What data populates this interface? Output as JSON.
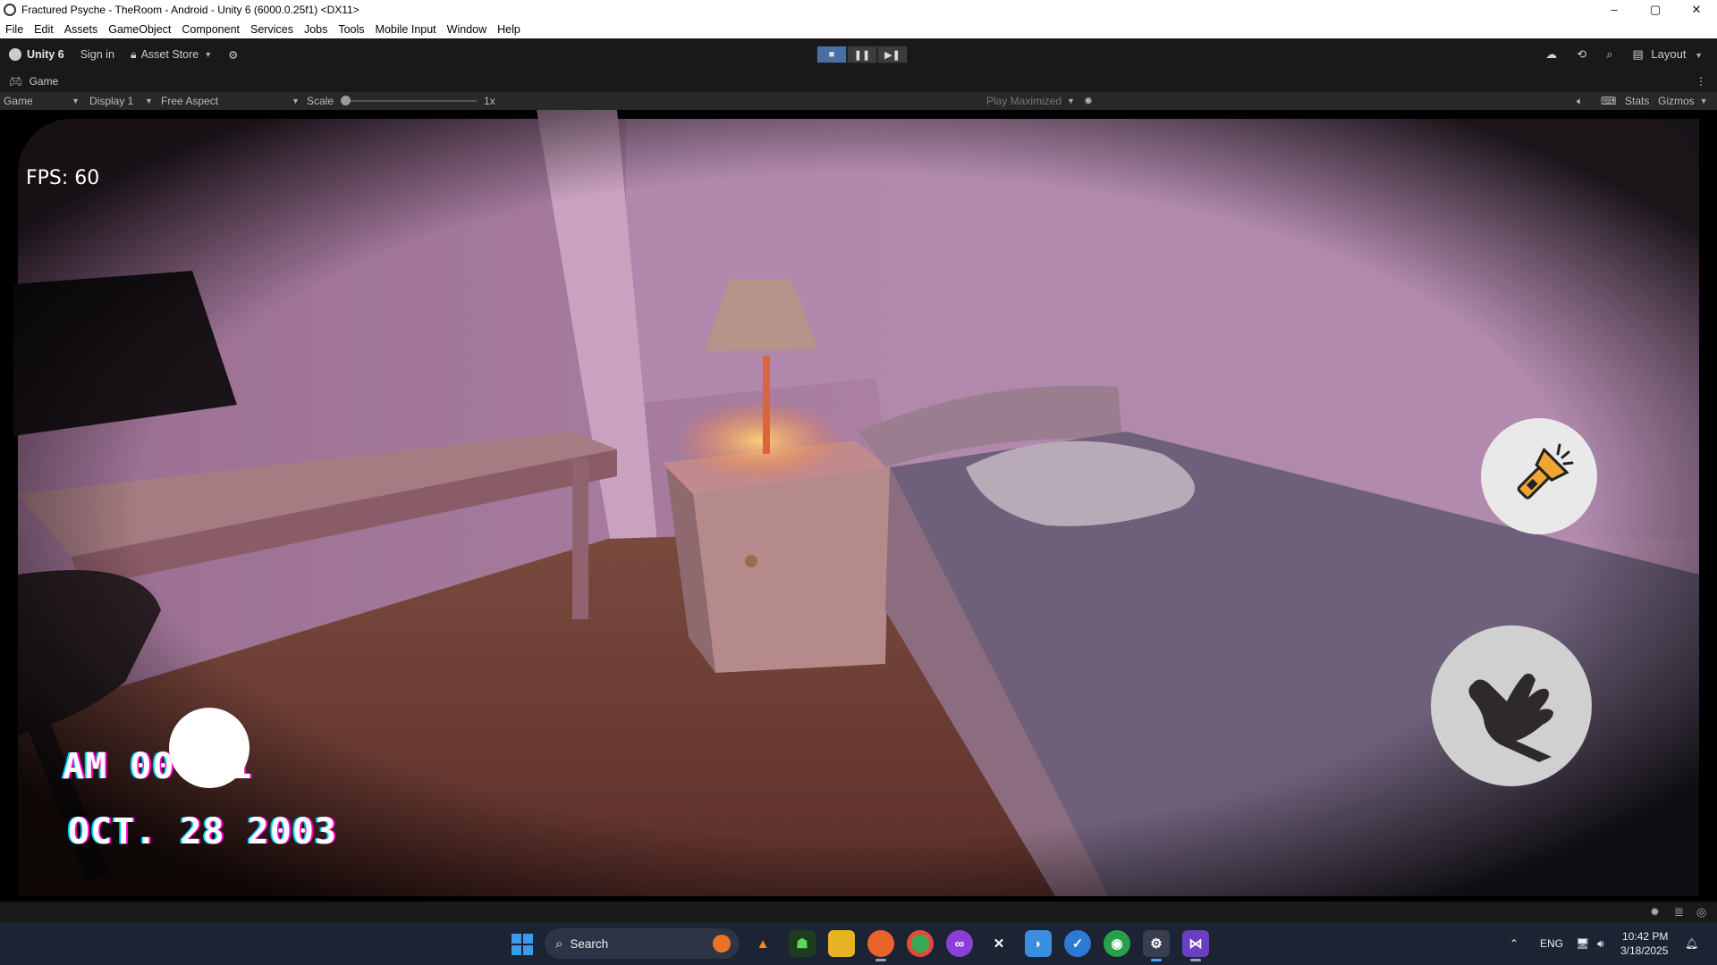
{
  "window": {
    "title": "Fractured Psyche - TheRoom - Android - Unity 6 (6000.0.25f1) <DX11>",
    "controls": [
      "–",
      "▢",
      "✕"
    ]
  },
  "menu": [
    "File",
    "Edit",
    "Assets",
    "GameObject",
    "Component",
    "Services",
    "Jobs",
    "Tools",
    "Mobile Input",
    "Window",
    "Help"
  ],
  "toolbar": {
    "account": "Unity 6",
    "sign_in": "Sign in",
    "asset_store": "Asset Store",
    "layout": "Layout",
    "play_state": "playing"
  },
  "tab": {
    "label": "Game"
  },
  "gamebar": {
    "view_mode": "Game",
    "display": "Display 1",
    "aspect": "Free Aspect",
    "scale_label": "Scale",
    "scale_value": "1x",
    "play_mode": "Play Maximized",
    "stats": "Stats",
    "gizmos": "Gizmos"
  },
  "hud": {
    "fps": "FPS: 60",
    "time": "AM 00",
    "time_tail": "1",
    "date": "OCT. 28 2003"
  },
  "taskbar": {
    "search_placeholder": "Search",
    "language": "ENG",
    "time": "10:42 PM",
    "date": "3/18/2025"
  },
  "colors": {
    "accent": "#4a6fa3",
    "editor_bg": "#191919",
    "taskbar_bg": "#1c2333"
  }
}
